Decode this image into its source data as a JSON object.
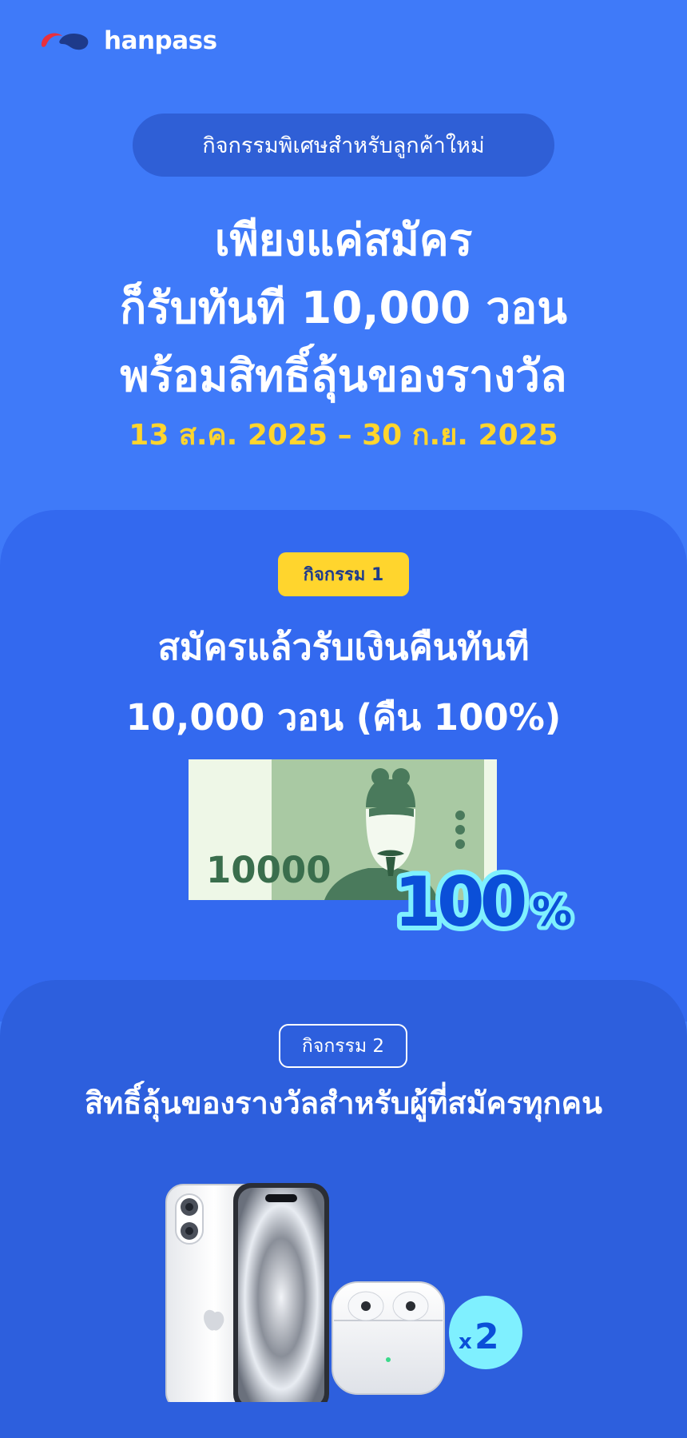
{
  "brand": {
    "name": "hanpass",
    "colors": {
      "red": "#e8303e",
      "navy": "#1e3a8a"
    }
  },
  "hero": {
    "pill_text": "กิจกรรมพิเศษสำหรับลูกค้าใหม่",
    "title_lines": [
      "เพียงแค่สมัคร",
      "ก็รับทันที 10,000 วอน",
      "พร้อมสิทธิ์ลุ้นของรางวัล"
    ],
    "date_range": "13 ส.ค. 2025 – 30 ก.ย. 2025"
  },
  "event1": {
    "badge": "กิจกรรม 1",
    "title_lines": [
      "สมัครแล้วรับเงินคืนทันที",
      "10,000 วอน (คืน 100%)"
    ],
    "banknote_value": "10000",
    "percent_label": "100",
    "percent_sign": "%"
  },
  "event2": {
    "badge": "กิจกรรม 2",
    "title": "สิทธิ์ลุ้นของรางวัลสำหรับผู้ที่สมัครทุกคน",
    "multiplier_prefix": "x",
    "multiplier_value": "2"
  },
  "colors": {
    "background": "#3f7af9",
    "card1": "#3369ef",
    "card2": "#2d5fdd",
    "accent_yellow": "#ffd52d",
    "accent_cyan": "#7ff0ff"
  }
}
